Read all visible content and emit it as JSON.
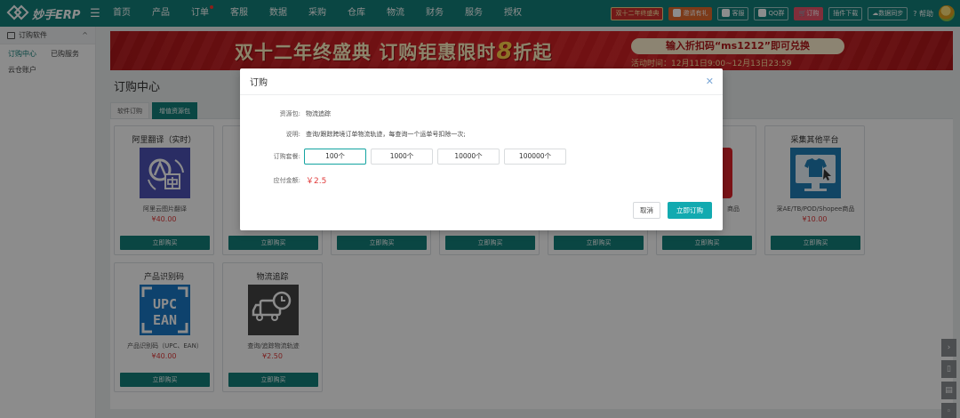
{
  "topnav": {
    "logo_text": "妙手ERP",
    "items": [
      {
        "label": "首页"
      },
      {
        "label": "产品"
      },
      {
        "label": "订单",
        "dot": true
      },
      {
        "label": "客服"
      },
      {
        "label": "数据"
      },
      {
        "label": "采购"
      },
      {
        "label": "仓库"
      },
      {
        "label": "物流"
      },
      {
        "label": "财务"
      },
      {
        "label": "服务"
      },
      {
        "label": "授权"
      }
    ],
    "right": {
      "promo": "双十二年终盛典",
      "invite": "邀请有礼",
      "service": "客服",
      "qq": "QQ群",
      "order": "订购",
      "plugin": "插件下载",
      "sync": "数据同步",
      "help": "帮助"
    }
  },
  "sidebar": {
    "group_label": "订购软件",
    "links": [
      "订购中心",
      "已购服务"
    ],
    "sub": "云仓账户"
  },
  "banner": {
    "title": "双十二年终盛典 订购钜惠限时",
    "big": "8",
    "title_tail": "折起",
    "code": "输入折扣码“ms1212”即可兑换",
    "time": "活动时间：12月11日9:00~12月13日23:59"
  },
  "page": {
    "title": "订购中心",
    "tabs": [
      "软件订购",
      "增值资源包"
    ]
  },
  "cards": [
    {
      "title": "阿里翻译（实时）",
      "desc": "阿里云图片翻译",
      "price": "¥40.00",
      "btn": "立即购买",
      "icon": "aliyun-translate-icon"
    },
    {
      "title": "",
      "desc": "",
      "price": "",
      "btn": "立即购买",
      "icon": "placeholder"
    },
    {
      "title": "",
      "desc": "",
      "price": "",
      "btn": "立即购买",
      "icon": "placeholder"
    },
    {
      "title": "",
      "desc": "",
      "price": "",
      "btn": "立即购买",
      "icon": "placeholder"
    },
    {
      "title": "",
      "desc": "",
      "price": "",
      "btn": "立即购买",
      "icon": "placeholder"
    },
    {
      "title": "",
      "desc": "商品",
      "price": "",
      "btn": "立即购买",
      "icon": "shopping-cart-icon"
    },
    {
      "title": "采集其他平台",
      "desc": "采AE/TB/POD/Shopee商品",
      "price": "¥10.00",
      "btn": "立即购买",
      "icon": "tshirt-screen-icon"
    },
    {
      "title": "产品识别码",
      "desc": "产品识别码（UPC、EAN）",
      "price": "¥40.00",
      "btn": "立即购买",
      "icon": "upc-ean-icon",
      "img_text1": "UPC",
      "img_text2": "EAN"
    },
    {
      "title": "物流追踪",
      "desc": "查询/追踪物流轨迹",
      "price": "¥2.50",
      "btn": "立即购买",
      "icon": "truck-clock-icon"
    }
  ],
  "modal": {
    "title": "订购",
    "package_label": "资源包:",
    "package_value": "物流追踪",
    "desc_label": "说明:",
    "desc_value": "查询/跟踪跨境订单物流轨迹，每查询一个运单号扣除一次;",
    "plan_label": "订购套餐:",
    "options": [
      "100个",
      "1000个",
      "10000个",
      "100000个"
    ],
    "selected_option_index": 0,
    "amount_label": "应付金额:",
    "amount_value": "￥2.5",
    "cancel": "取消",
    "confirm": "立即订购"
  },
  "colors": {
    "primary": "#13807a",
    "accent": "#12aab0",
    "price": "#e03b3b",
    "banner": "#d62125"
  }
}
